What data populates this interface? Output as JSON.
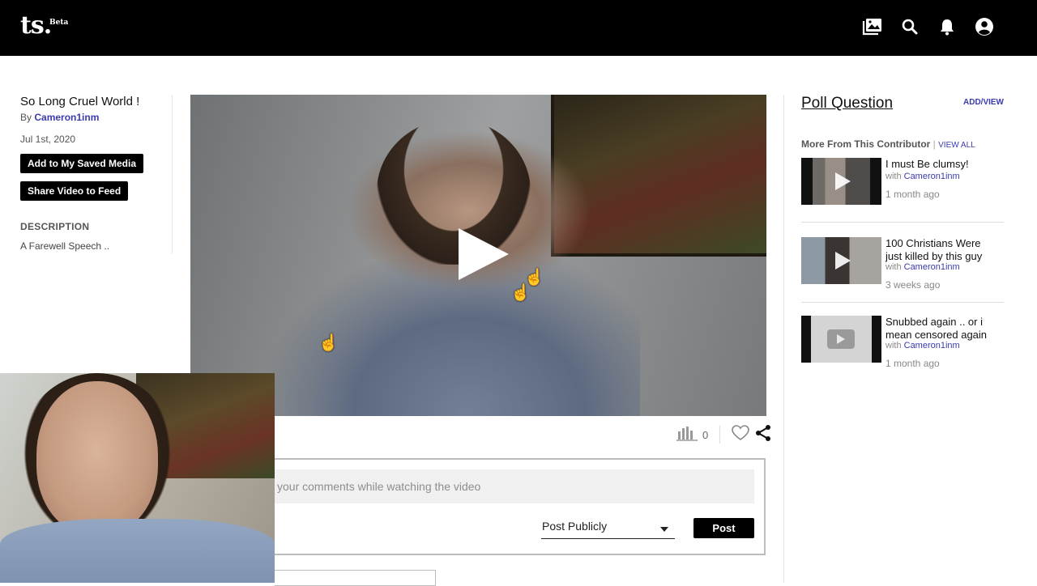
{
  "header": {
    "logo": "ts.",
    "logo_badge": "Beta",
    "icons": [
      "gallery-icon",
      "search-icon",
      "bell-icon",
      "account-icon"
    ]
  },
  "video": {
    "title": "So Long Cruel World !",
    "by_prefix": "By",
    "author": "Cameron1inm",
    "date": "Jul 1st, 2020",
    "save_label": "Add to My Saved Media",
    "share_label": "Share Video to Feed",
    "description_heading": "DESCRIPTION",
    "description": "A Farewell Speech ..",
    "view_count": "0"
  },
  "comment": {
    "placeholder": "your comments while watching the video",
    "privacy_selected": "Post Publicly",
    "post_label": "Post"
  },
  "sidebar": {
    "poll_title": "Poll Question",
    "add_view": "ADD/VIEW",
    "more_heading": "More From This Contributor",
    "view_all_sep": "|",
    "view_all": "VIEW ALL",
    "related": [
      {
        "title": "I must Be clumsy!",
        "with": "with",
        "author": "Cameron1inm",
        "ago": "1 month ago"
      },
      {
        "title": "100 Christians Were just killed by this guy",
        "with": "with",
        "author": "Cameron1inm",
        "ago": "3 weeks ago"
      },
      {
        "title": "Snubbed again .. or i mean censored again",
        "with": "with",
        "author": "Cameron1inm",
        "ago": "1 month ago"
      }
    ]
  },
  "colors": {
    "topbar": "#000000",
    "link": "#3a3ab0",
    "button": "#000000"
  }
}
